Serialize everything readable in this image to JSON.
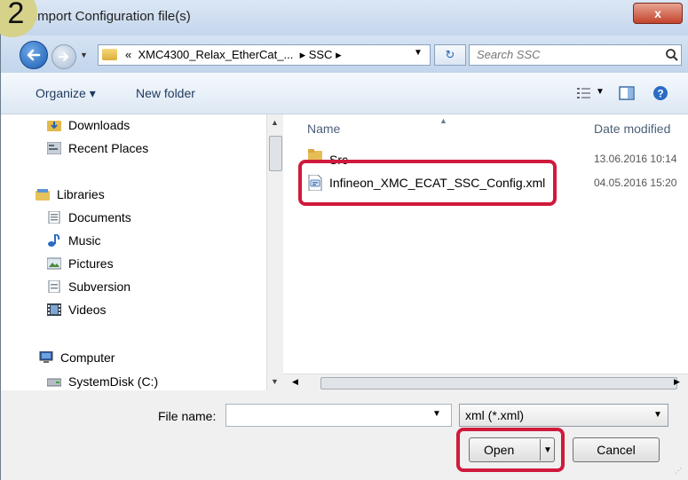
{
  "dialog": {
    "step_number": "2",
    "title": "Import Configuration file(s)",
    "close_label": "x"
  },
  "nav": {
    "path_prefix": "«",
    "path_segments": [
      "XMC4300_Relax_EtherCat_...",
      "SSC"
    ],
    "search_placeholder": "Search SSC"
  },
  "toolbar": {
    "organize_label": "Organize ▾",
    "new_folder_label": "New folder"
  },
  "sidebar": {
    "items": [
      {
        "label": "Downloads",
        "icon": "downloads-folder-icon"
      },
      {
        "label": "Recent Places",
        "icon": "recent-places-icon"
      },
      {
        "label": "Libraries",
        "icon": "libraries-icon"
      },
      {
        "label": "Documents",
        "icon": "documents-icon"
      },
      {
        "label": "Music",
        "icon": "music-icon"
      },
      {
        "label": "Pictures",
        "icon": "pictures-icon"
      },
      {
        "label": "Subversion",
        "icon": "subversion-icon"
      },
      {
        "label": "Videos",
        "icon": "videos-icon"
      },
      {
        "label": "Computer",
        "icon": "computer-icon"
      },
      {
        "label": "SystemDisk (C:)",
        "icon": "disk-icon"
      }
    ]
  },
  "file_list": {
    "columns": {
      "name": "Name",
      "date": "Date modified"
    },
    "files": [
      {
        "name": "Src",
        "date": "13.06.2016 10:14",
        "type": "folder"
      },
      {
        "name": "Infineon_XMC_ECAT_SSC_Config.xml",
        "date": "04.05.2016 15:20",
        "type": "xml"
      }
    ]
  },
  "footer": {
    "filename_label": "File name:",
    "filename_value": "",
    "filetype_value": "xml  (*.xml)",
    "open_label": "Open",
    "cancel_label": "Cancel"
  },
  "colors": {
    "highlight": "#d01a3c",
    "badge": "#d6d28a"
  }
}
